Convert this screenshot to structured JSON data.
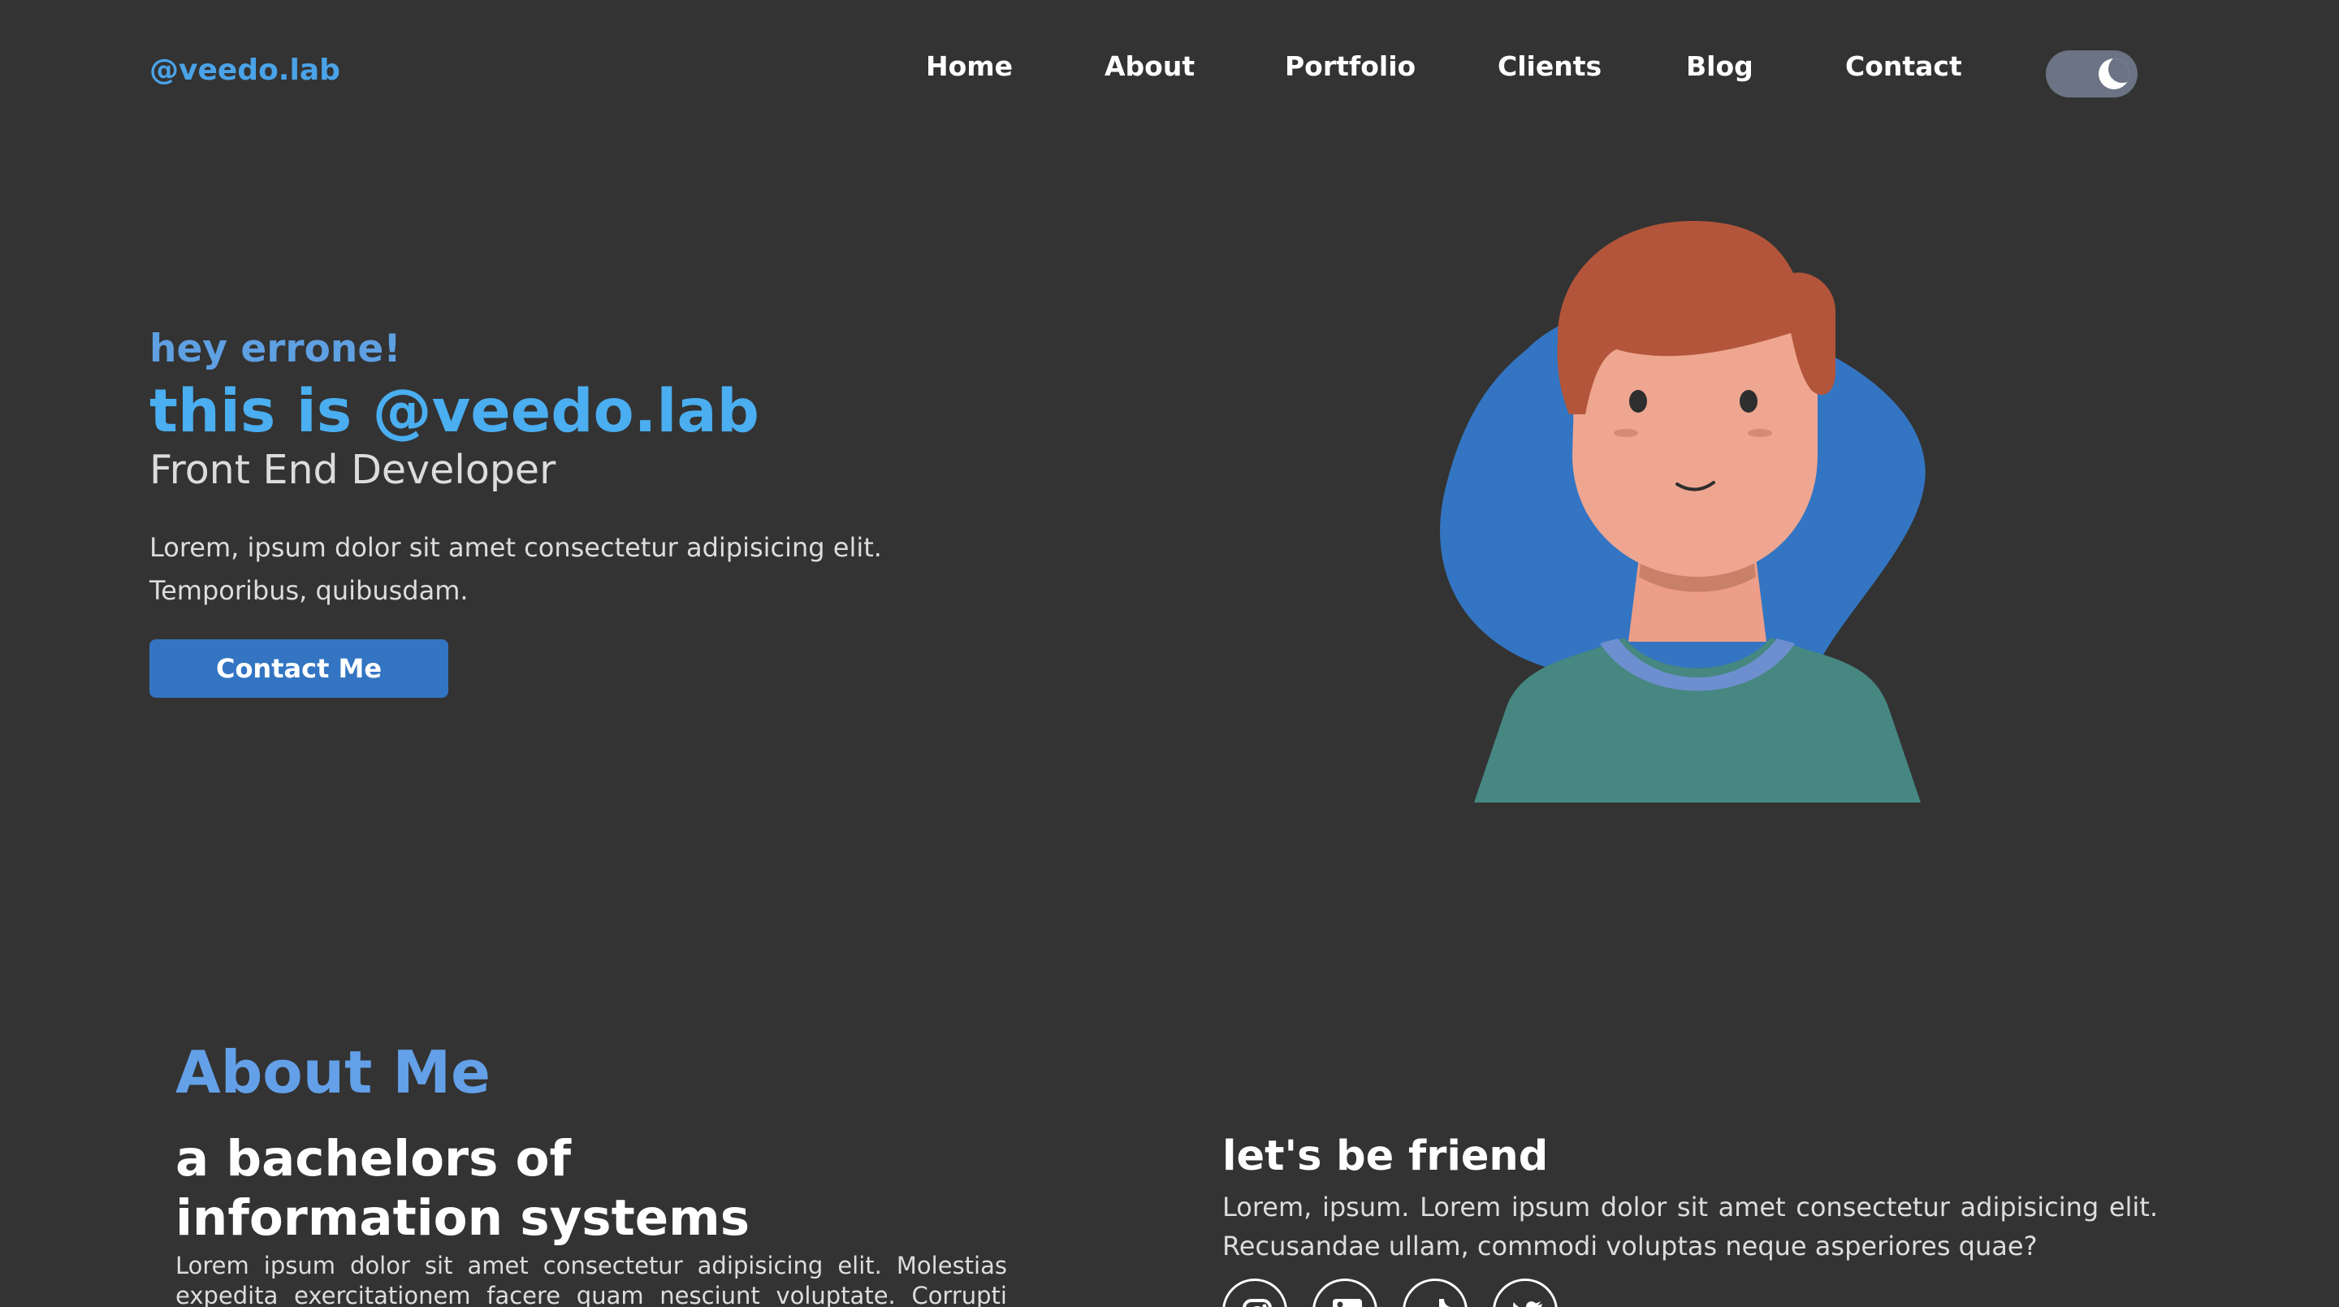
{
  "header": {
    "logo": "@veedo.lab",
    "nav": [
      "Home",
      "About",
      "Portfolio",
      "Clients",
      "Blog",
      "Contact"
    ],
    "theme_toggle_icon": "moon-icon"
  },
  "hero": {
    "greeting": "hey errone!",
    "title": "this is @veedo.lab",
    "role": "Front End Developer",
    "description": "Lorem, ipsum dolor sit amet consectetur adipisicing elit. Temporibus, quibusdam.",
    "button": "Contact Me",
    "illustration": "developer-avatar"
  },
  "about": {
    "title": "About Me",
    "subtitle": "a bachelors of information systems",
    "text": "Lorem ipsum dolor sit amet consectetur adipisicing elit. Molestias expedita exercitationem facere quam nesciunt voluptate. Corrupti laborum ullam sed",
    "friend_title": "let's be friend",
    "friend_text": "Lorem, ipsum. Lorem ipsum dolor sit amet consectetur adipisicing elit. Recusandae ullam, commodi voluptas neque asperiores quae?",
    "social_icons": [
      "instagram-icon",
      "linkedin-icon",
      "tiktok-icon",
      "twitter-icon"
    ]
  },
  "colors": {
    "background": "#333333",
    "accent": "#4aa3e8",
    "button": "#3375c2"
  }
}
